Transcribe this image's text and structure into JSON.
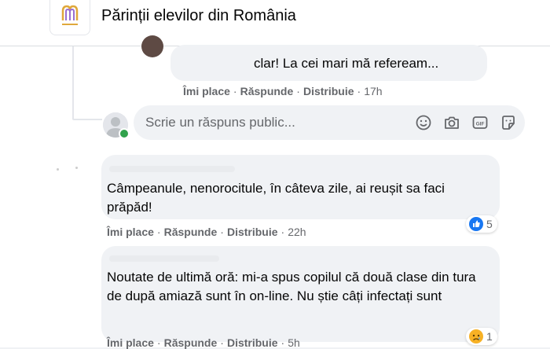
{
  "header": {
    "group_title": "Părinții elevilor din România"
  },
  "comments": [
    {
      "text": "clar! La cei mari mă refeream...",
      "actions": {
        "like": "Îmi place",
        "reply": "Răspunde",
        "share": "Distribuie",
        "time": "17h"
      }
    },
    {
      "text": "Câmpeanule, nenorocitule, în câteva zile, ai reușit sa faci prăpăd!",
      "actions": {
        "like": "Îmi place",
        "reply": "Răspunde",
        "share": "Distribuie",
        "time": "22h"
      },
      "reaction": {
        "icon": "like-reaction-icon",
        "count": "5"
      }
    },
    {
      "text": "Noutate de ultimă oră: mi-a spus copilul că două clase din tura de după amiază sunt în on-line. Nu știe câți infectați sunt",
      "actions": {
        "like": "Îmi place",
        "reply": "Răspunde",
        "share": "Distribuie",
        "time": "5h"
      },
      "reaction": {
        "icon": "sad-reaction-icon",
        "count": "1"
      }
    }
  ],
  "reply_box": {
    "placeholder": "Scrie un răspuns public...",
    "icons": [
      "emoji-icon",
      "camera-icon",
      "gif-icon",
      "sticker-icon"
    ]
  },
  "colors": {
    "background": "#ffffff",
    "bubble": "#f0f2f5",
    "secondary_text": "#65676b",
    "like_blue": "#1877f2",
    "online_green": "#31a24c",
    "sad_yellow": "#f7b125"
  }
}
